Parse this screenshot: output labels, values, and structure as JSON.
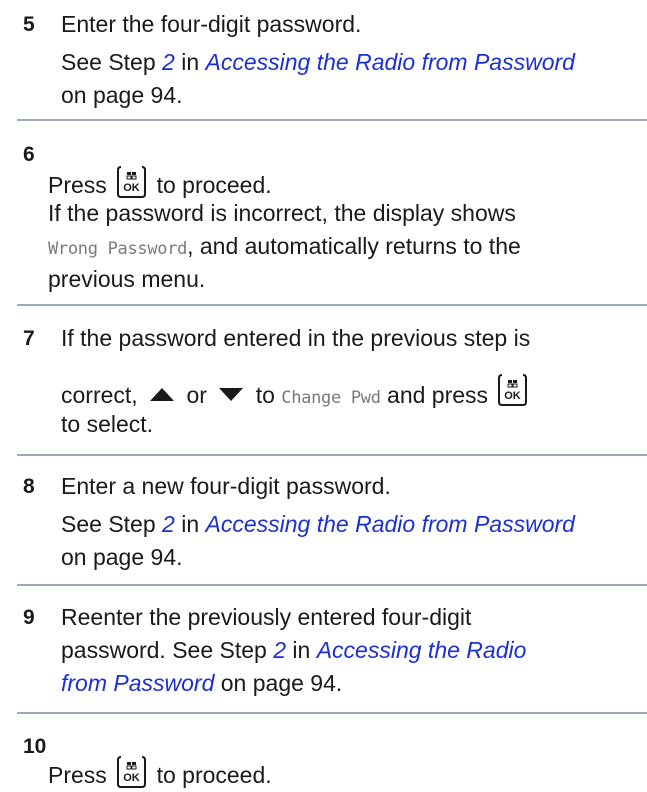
{
  "steps": [
    {
      "number": "5",
      "lines": {
        "l1": "Enter the four-digit password.",
        "l2_prefix": "See Step ",
        "l2_step": "2",
        "l2_mid": " in ",
        "l2_link": "Accessing the Radio from Password",
        "l3": "on page 94."
      }
    },
    {
      "number": "6",
      "lines": {
        "l1_before": "Press",
        "l1_after": "to proceed.",
        "l2": "If the password is incorrect, the display shows",
        "l3_mono": "Wrong Password",
        "l3_rest": ", and automatically returns to the",
        "l4": "previous menu."
      }
    },
    {
      "number": "7",
      "lines": {
        "l1": "If the password entered in the previous step is",
        "l2_a": "correct,",
        "l2_or": "or",
        "l2_to": "to",
        "l2_mono": "Change Pwd",
        "l2_b": "and press",
        "l3": "to select."
      }
    },
    {
      "number": "8",
      "lines": {
        "l1": "Enter a new four-digit password.",
        "l2_prefix": "See Step ",
        "l2_step": "2",
        "l2_mid": " in ",
        "l2_link": "Accessing the Radio from Password",
        "l3": "on page 94."
      }
    },
    {
      "number": "9",
      "lines": {
        "l1": "Reenter the previously entered four-digit",
        "l2_prefix": "password. See Step ",
        "l2_step": "2",
        "l2_mid": " in ",
        "l2_link": "Accessing the Radio",
        "l3_link": "from Password",
        "l3_rest": " on page 94."
      }
    },
    {
      "number": "10",
      "lines": {
        "l1_before": "Press",
        "l1_after": "to proceed."
      }
    }
  ],
  "icons": {
    "ok_button": "ok-menu-button-icon",
    "up_arrow": "up-arrow-icon",
    "down_arrow": "down-arrow-icon"
  },
  "colors": {
    "link": "#1a2fd6",
    "separator": "#9aaabb",
    "mono_text": "#7a7a7a"
  }
}
